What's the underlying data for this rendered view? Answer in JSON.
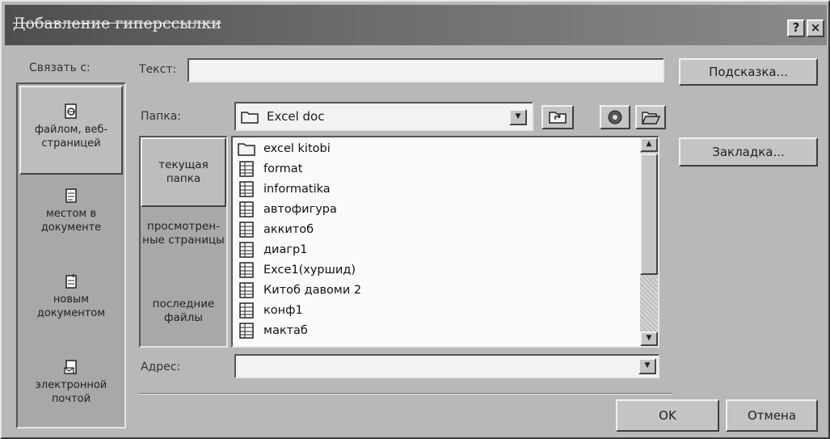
{
  "dialog": {
    "title": "Добавление гиперссылки",
    "help_btn": "?",
    "close_btn": "×"
  },
  "link_to": {
    "label": "Связать с:",
    "items": [
      {
        "label": "файлом, веб-страницей",
        "icon": "web-page-icon",
        "active": true
      },
      {
        "label": "местом в документе",
        "icon": "document-place-icon",
        "active": false
      },
      {
        "label": "новым документом",
        "icon": "new-document-icon",
        "active": false
      },
      {
        "label": "электронной почтой",
        "icon": "email-icon",
        "active": false
      }
    ]
  },
  "text_field": {
    "label": "Текст:",
    "value": ""
  },
  "tooltip_button": "Подсказка...",
  "folder": {
    "label": "Папка:",
    "value": "Excel doc"
  },
  "bookmark_button": "Закладка...",
  "sources": [
    {
      "label": "текущая папка",
      "active": true
    },
    {
      "label": "просмотрен-ные страницы",
      "active": false
    },
    {
      "label": "последние файлы",
      "active": false
    }
  ],
  "files": [
    {
      "name": "excel kitobi",
      "type": "folder"
    },
    {
      "name": "format",
      "type": "file"
    },
    {
      "name": "informatika",
      "type": "file"
    },
    {
      "name": "автофигура",
      "type": "file"
    },
    {
      "name": "аккитоб",
      "type": "file"
    },
    {
      "name": "диагр1",
      "type": "file"
    },
    {
      "name": "Exce1(хуршид)",
      "type": "file"
    },
    {
      "name": "Китоб давоми 2",
      "type": "file"
    },
    {
      "name": "конф1",
      "type": "file"
    },
    {
      "name": "мактаб",
      "type": "file"
    }
  ],
  "address": {
    "label": "Адрес:",
    "value": ""
  },
  "ok_button": "OK",
  "cancel_button": "Отмена"
}
